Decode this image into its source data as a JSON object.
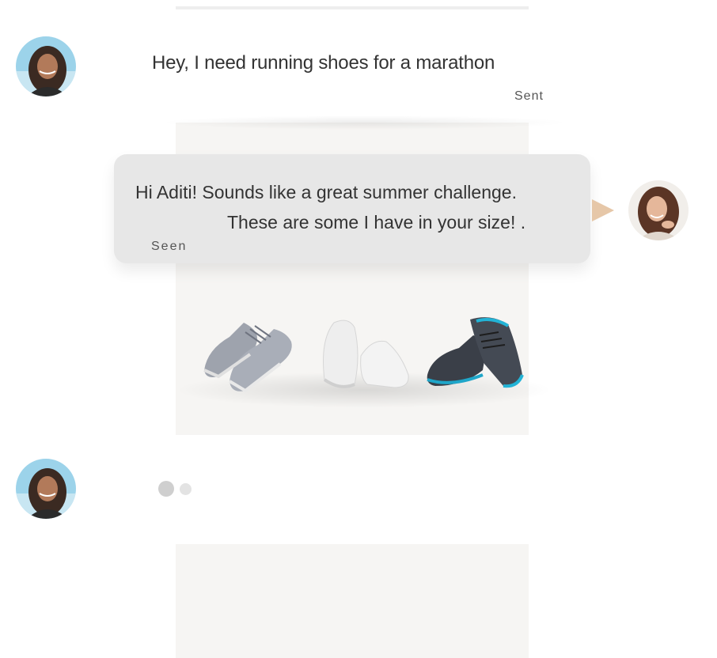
{
  "conversation": {
    "messages": [
      {
        "sender": "Aditi",
        "text": "Hey, I need running shoes for a marathon",
        "status": "Sent"
      },
      {
        "sender": "agent",
        "text_line1": "Hi Aditi! Sounds like a great summer challenge.",
        "text_line2": "These are some I have in your size!  .",
        "status": "Seen"
      }
    ],
    "product_images": [
      "grey-knit-sneakers",
      "white-sneakers",
      "black-teal-trail-shoes"
    ]
  },
  "colors": {
    "bubble": "#e7e7e7",
    "pointer": "#e6c7a8",
    "column": "#f6f5f3"
  }
}
